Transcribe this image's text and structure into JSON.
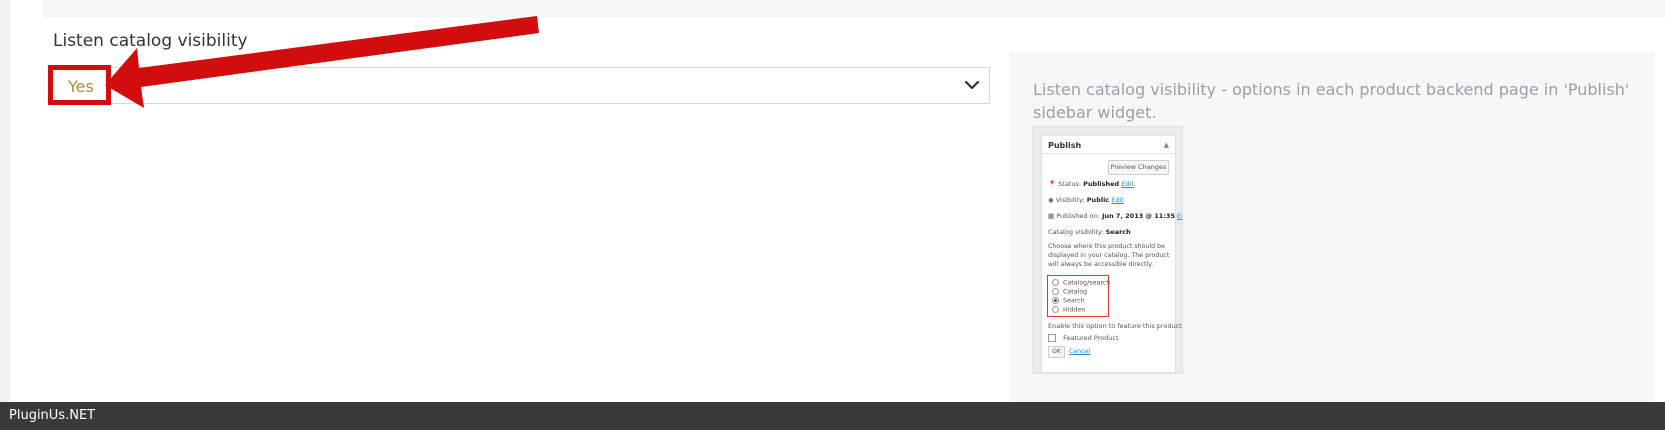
{
  "setting": {
    "label": "Listen catalog visibility",
    "selected_value": "Yes"
  },
  "description": {
    "text": "Listen catalog visibility - options in each product backend page in 'Publish' sidebar widget."
  },
  "screenshot_example": {
    "title": "Publish",
    "preview_button": "Preview Changes",
    "status_label": "Status:",
    "status_value": "Published",
    "visibility_label": "Visibility:",
    "visibility_value": "Public",
    "published_label": "Published on:",
    "published_value": "Jun 7, 2013 @ 11:35",
    "edit_link": "Edit",
    "catalog_visibility_label": "Catalog visibility:",
    "catalog_visibility_value": "Search",
    "help_text": "Choose where this product should be displayed in your catalog. The product will always be accessible directly.",
    "options": [
      "Catalog/search",
      "Catalog",
      "Search",
      "Hidden"
    ],
    "featured_hint": "Enable this option to feature this product.",
    "featured_checkbox": "Featured Product",
    "ok_button": "OK",
    "cancel_link": "Cancel"
  },
  "footer": {
    "brand": "PluginUs.NET"
  },
  "colors": {
    "annotation_red": "#d10d0d",
    "selected_text": "#b58a3c",
    "footer_bg": "#3a3a3a"
  }
}
